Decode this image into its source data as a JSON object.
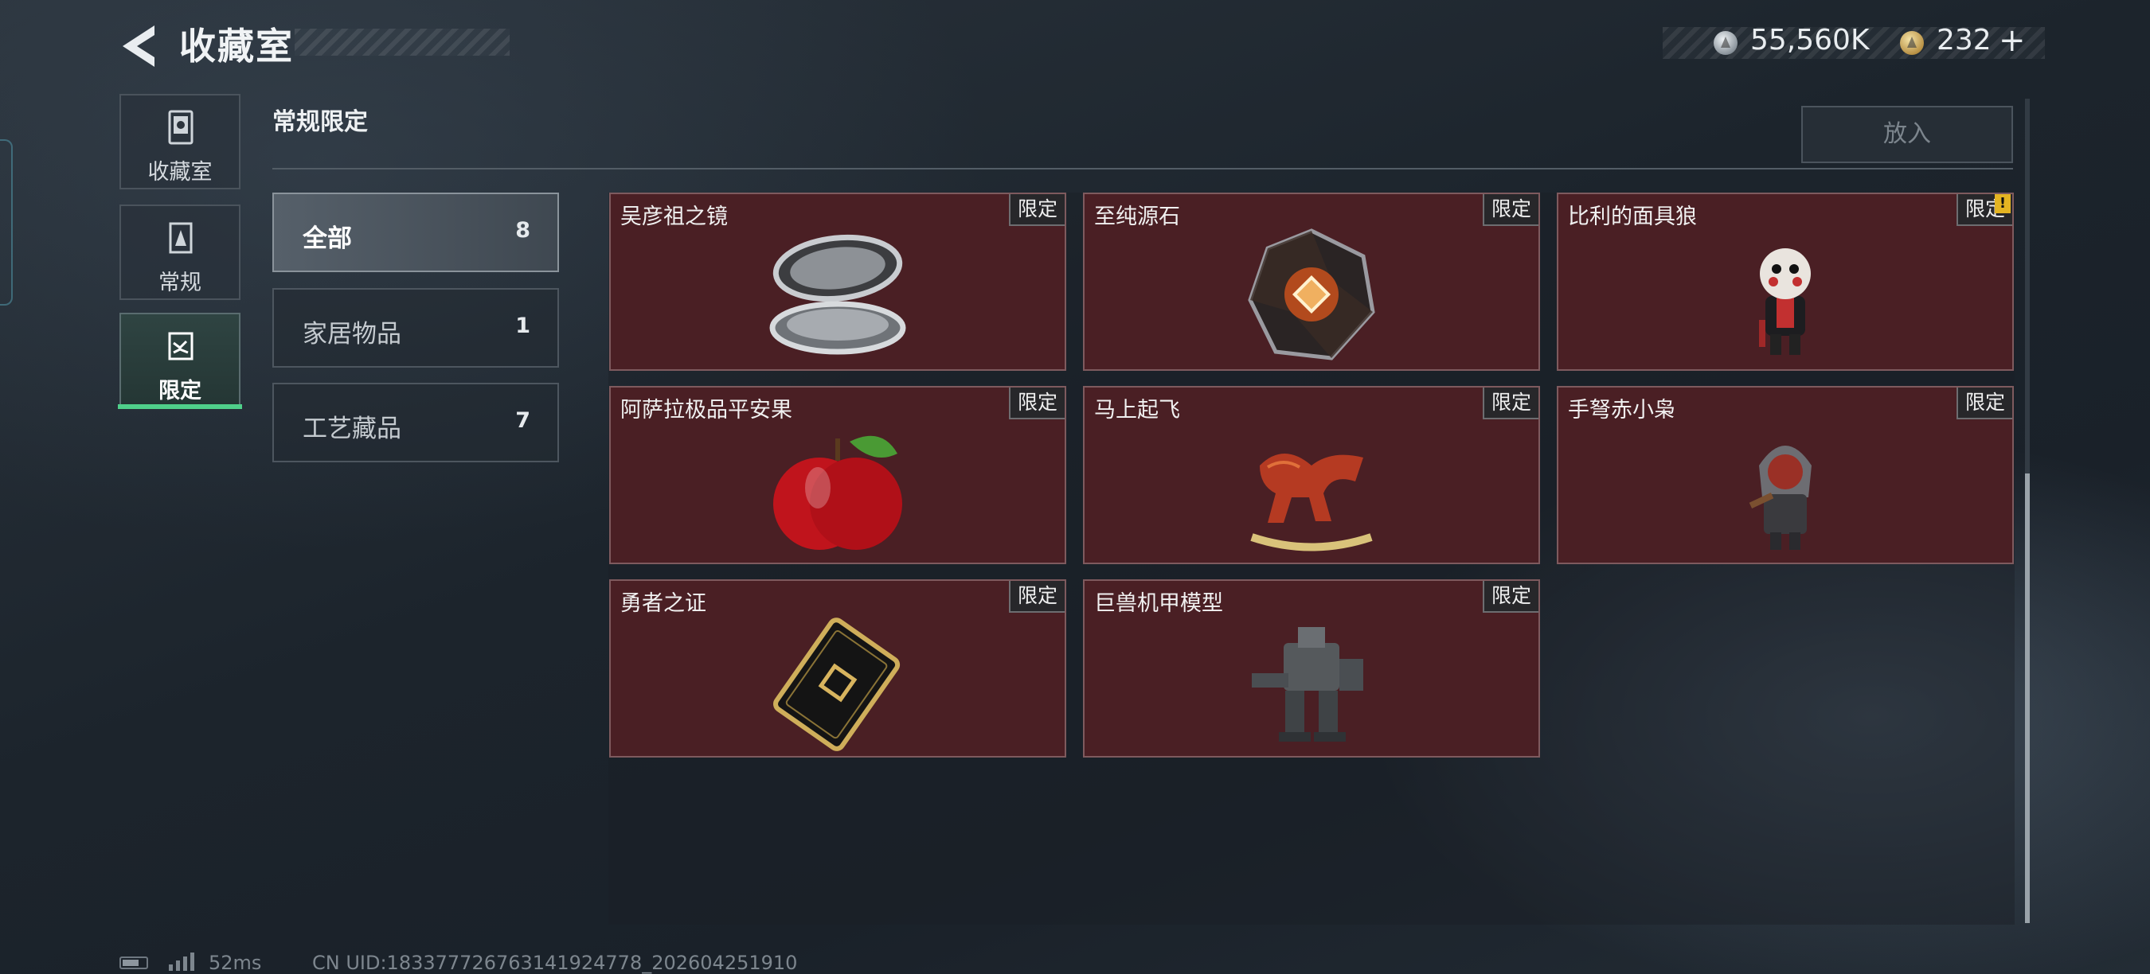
{
  "header": {
    "title": "收藏室"
  },
  "currency": {
    "silver_amount": "55,560K",
    "gold_amount": "232",
    "add_symbol": "+"
  },
  "nav": {
    "items": [
      {
        "label": "收藏室",
        "icon": "collection-icon"
      },
      {
        "label": "常规",
        "icon": "regular-icon"
      },
      {
        "label": "限定",
        "icon": "limited-icon",
        "selected": true
      }
    ]
  },
  "section": {
    "title": "常规限定",
    "place_button": "放入"
  },
  "categories": [
    {
      "label": "全部",
      "count": "8",
      "selected": true
    },
    {
      "label": "家居物品",
      "count": "1"
    },
    {
      "label": "工艺藏品",
      "count": "7"
    }
  ],
  "items": [
    {
      "name": "吴彦祖之镜",
      "tag": "限定",
      "icon": "compact-mirror-icon"
    },
    {
      "name": "至纯源石",
      "tag": "限定",
      "icon": "source-stone-icon"
    },
    {
      "name": "比利的面具狼",
      "tag": "限定",
      "icon": "masked-figure-icon",
      "badge": "!"
    },
    {
      "name": "阿萨拉极品平安果",
      "tag": "限定",
      "icon": "apple-icon"
    },
    {
      "name": "马上起飞",
      "tag": "限定",
      "icon": "rocking-horse-icon"
    },
    {
      "name": "手弩赤小枭",
      "tag": "限定",
      "icon": "hooded-figure-icon"
    },
    {
      "name": "勇者之证",
      "tag": "限定",
      "icon": "card-icon"
    },
    {
      "name": "巨兽机甲模型",
      "tag": "限定",
      "icon": "mech-model-icon"
    }
  ],
  "footer": {
    "ping": "52ms",
    "uid": "CN UID:1833777267631419247​78_202604251910"
  },
  "colors": {
    "accent_green": "#4fd08a",
    "card_bg": "#4a1f24",
    "card_border": "#7e5a5e"
  }
}
